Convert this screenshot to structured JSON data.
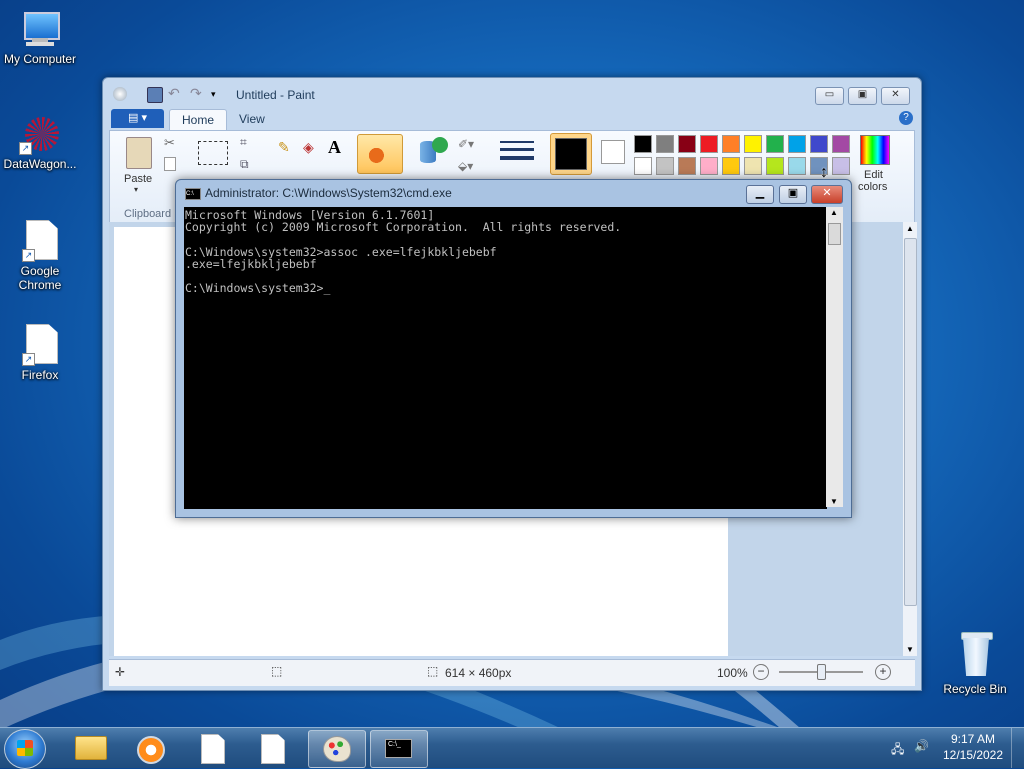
{
  "desktop": {
    "icons": [
      {
        "label": "My Computer"
      },
      {
        "label": "DataWagon..."
      },
      {
        "label": "Google Chrome"
      },
      {
        "label": "Firefox"
      },
      {
        "label": "Recycle Bin"
      }
    ]
  },
  "paint": {
    "title": "Untitled - Paint",
    "tabs": {
      "home": "Home",
      "view": "View"
    },
    "ribbon": {
      "paste": "Paste",
      "clipboard_group": "Clipboard",
      "edit_colors_line1": "Edit",
      "edit_colors_line2": "colors"
    },
    "colors": {
      "row1": [
        "#000000",
        "#7f7f7f",
        "#880015",
        "#ed1c24",
        "#ff7f27",
        "#fff200",
        "#22b14c",
        "#00a2e8",
        "#3f48cc",
        "#a349a4"
      ],
      "row2": [
        "#ffffff",
        "#c3c3c3",
        "#b97a57",
        "#ffaec9",
        "#ffc90e",
        "#efe4b0",
        "#b5e61d",
        "#99d9ea",
        "#7092be",
        "#c8bfe7"
      ],
      "color1": "#000000",
      "color2": "#ffffff"
    },
    "status": {
      "size": "614 × 460px",
      "zoom": "100%"
    }
  },
  "cmd": {
    "title": "Administrator: C:\\Windows\\System32\\cmd.exe",
    "lines": [
      "Microsoft Windows [Version 6.1.7601]",
      "Copyright (c) 2009 Microsoft Corporation.  All rights reserved.",
      "",
      "C:\\Windows\\system32>assoc .exe=lfejkbkljebebf",
      ".exe=lfejkbkljebebf",
      "",
      "C:\\Windows\\system32>_"
    ]
  },
  "taskbar": {
    "time": "9:17 AM",
    "date": "12/15/2022"
  }
}
